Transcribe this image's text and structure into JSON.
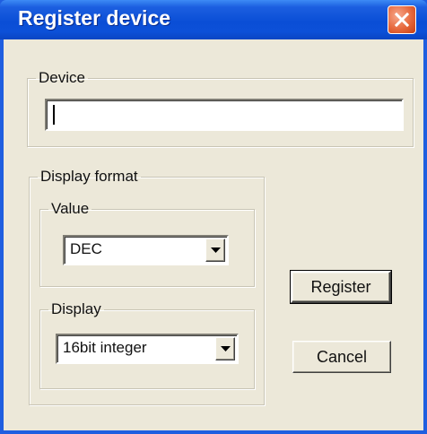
{
  "window": {
    "title": "Register device",
    "close_icon": "close-icon"
  },
  "device_group": {
    "legend": "Device",
    "input_value": ""
  },
  "display_format_group": {
    "legend": "Display format",
    "value_group": {
      "legend": "Value",
      "selected": "DEC"
    },
    "display_group": {
      "legend": "Display",
      "selected": "16bit integer"
    }
  },
  "buttons": {
    "register_label": "Register",
    "cancel_label": "Cancel"
  },
  "colors": {
    "titlebar": "#0a4ed6",
    "client_background": "#ece8d9",
    "close_button": "#e6683c"
  }
}
